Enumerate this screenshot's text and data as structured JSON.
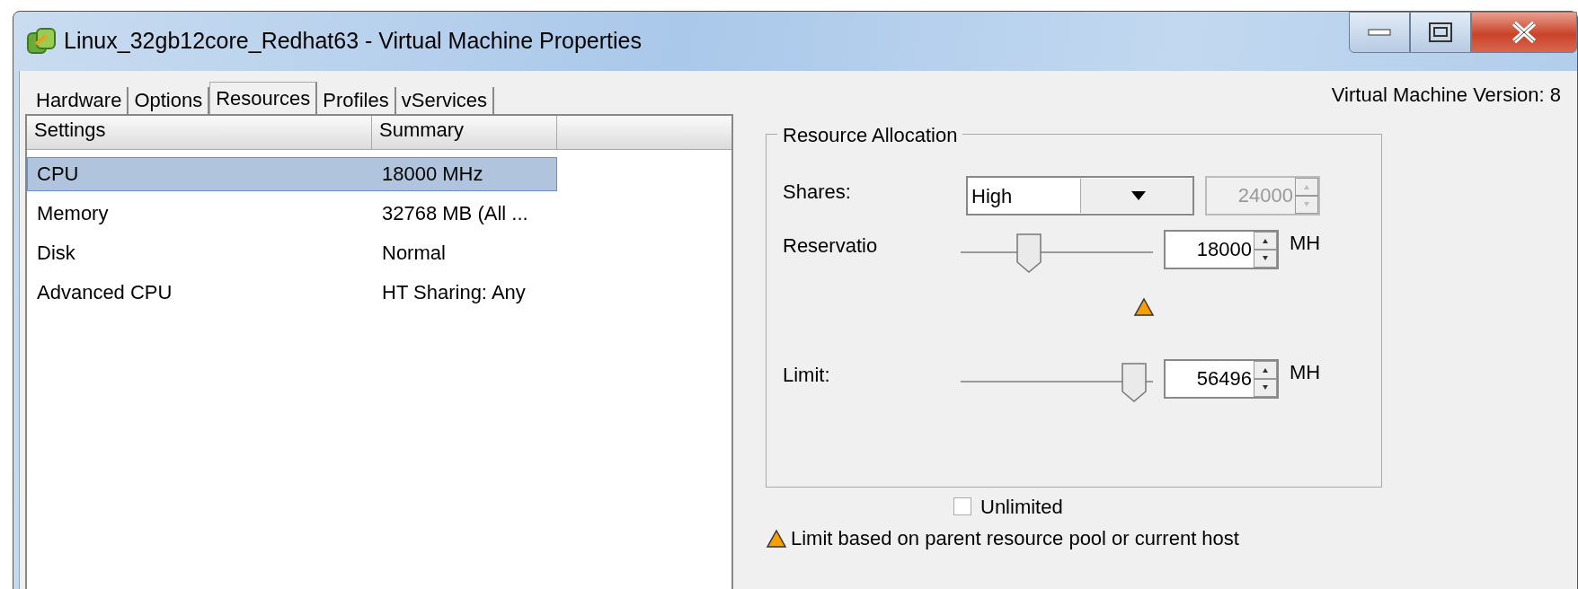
{
  "window": {
    "title": "Linux_32gb12core_Redhat63 - Virtual Machine Properties"
  },
  "tabs": [
    {
      "label": "Hardware",
      "selected": false
    },
    {
      "label": "Options",
      "selected": false
    },
    {
      "label": "Resources",
      "selected": true
    },
    {
      "label": "Profiles",
      "selected": false
    },
    {
      "label": "vServices",
      "selected": false
    }
  ],
  "version_label": "Virtual Machine Version: 8",
  "settings_table": {
    "columns": [
      "Settings",
      "Summary"
    ],
    "rows": [
      {
        "setting": "CPU",
        "summary": "18000 MHz",
        "selected": true
      },
      {
        "setting": "Memory",
        "summary": "32768 MB (All ...",
        "selected": false
      },
      {
        "setting": "Disk",
        "summary": "Normal",
        "selected": false
      },
      {
        "setting": "Advanced CPU",
        "summary": "HT Sharing: Any",
        "selected": false
      }
    ]
  },
  "resource_allocation": {
    "title": "Resource Allocation",
    "shares": {
      "label": "Shares:",
      "value": "High",
      "amount": "24000",
      "amount_disabled": true
    },
    "reservation": {
      "label": "Reservatio",
      "level": 0.33,
      "value": "18000",
      "unit": "MH",
      "warning": true
    },
    "limit": {
      "label": "Limit:",
      "level": 0.97,
      "value": "56496",
      "unit": "MH"
    },
    "unlimited": {
      "label": "Unlimited",
      "checked": false
    }
  },
  "note": {
    "text": "Limit based on parent resource pool or current host",
    "warning": true
  }
}
